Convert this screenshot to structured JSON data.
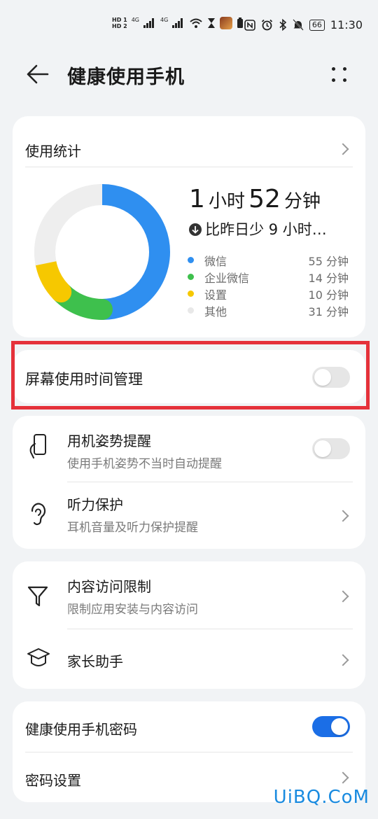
{
  "status_bar": {
    "hd1": "HD 1",
    "hd2": "HD 2",
    "net1": "4G",
    "net2": "4G",
    "battery": "66",
    "time": "11:30",
    "icons": [
      "nfc-icon",
      "alarm-icon",
      "bluetooth-icon",
      "mute-icon"
    ]
  },
  "header": {
    "title": "健康使用手机"
  },
  "usage_card": {
    "section_title": "使用统计",
    "total": {
      "hours": "1",
      "hour_unit": "小时",
      "minutes": "52",
      "minute_unit": "分钟"
    },
    "compare": "比昨日少 9 小时…",
    "legend": [
      {
        "name": "微信",
        "value": "55 分钟",
        "color": "#2f8ff0"
      },
      {
        "name": "企业微信",
        "value": "14 分钟",
        "color": "#3ec04d"
      },
      {
        "name": "设置",
        "value": "10 分钟",
        "color": "#f6c800"
      },
      {
        "name": "其他",
        "value": "31 分钟",
        "color": "#e8e8e8"
      }
    ]
  },
  "chart_data": {
    "type": "pie",
    "categories": [
      "微信",
      "企业微信",
      "设置",
      "其他"
    ],
    "values": [
      55,
      14,
      10,
      31
    ],
    "unit": "分钟",
    "colors": [
      "#2f8ff0",
      "#3ec04d",
      "#f6c800",
      "#eeeeee"
    ]
  },
  "screen_time": {
    "label": "屏幕使用时间管理",
    "enabled": false
  },
  "posture": {
    "title": "用机姿势提醒",
    "subtitle": "使用手机姿势不当时自动提醒",
    "enabled": false
  },
  "hearing": {
    "title": "听力保护",
    "subtitle": "耳机音量及听力保护提醒"
  },
  "content_limit": {
    "title": "内容访问限制",
    "subtitle": "限制应用安装与内容访问"
  },
  "parent": {
    "title": "家长助手"
  },
  "password_toggle": {
    "title": "健康使用手机密码",
    "enabled": true
  },
  "password_settings": {
    "title": "密码设置"
  },
  "watermark": "UiBQ.CoM"
}
